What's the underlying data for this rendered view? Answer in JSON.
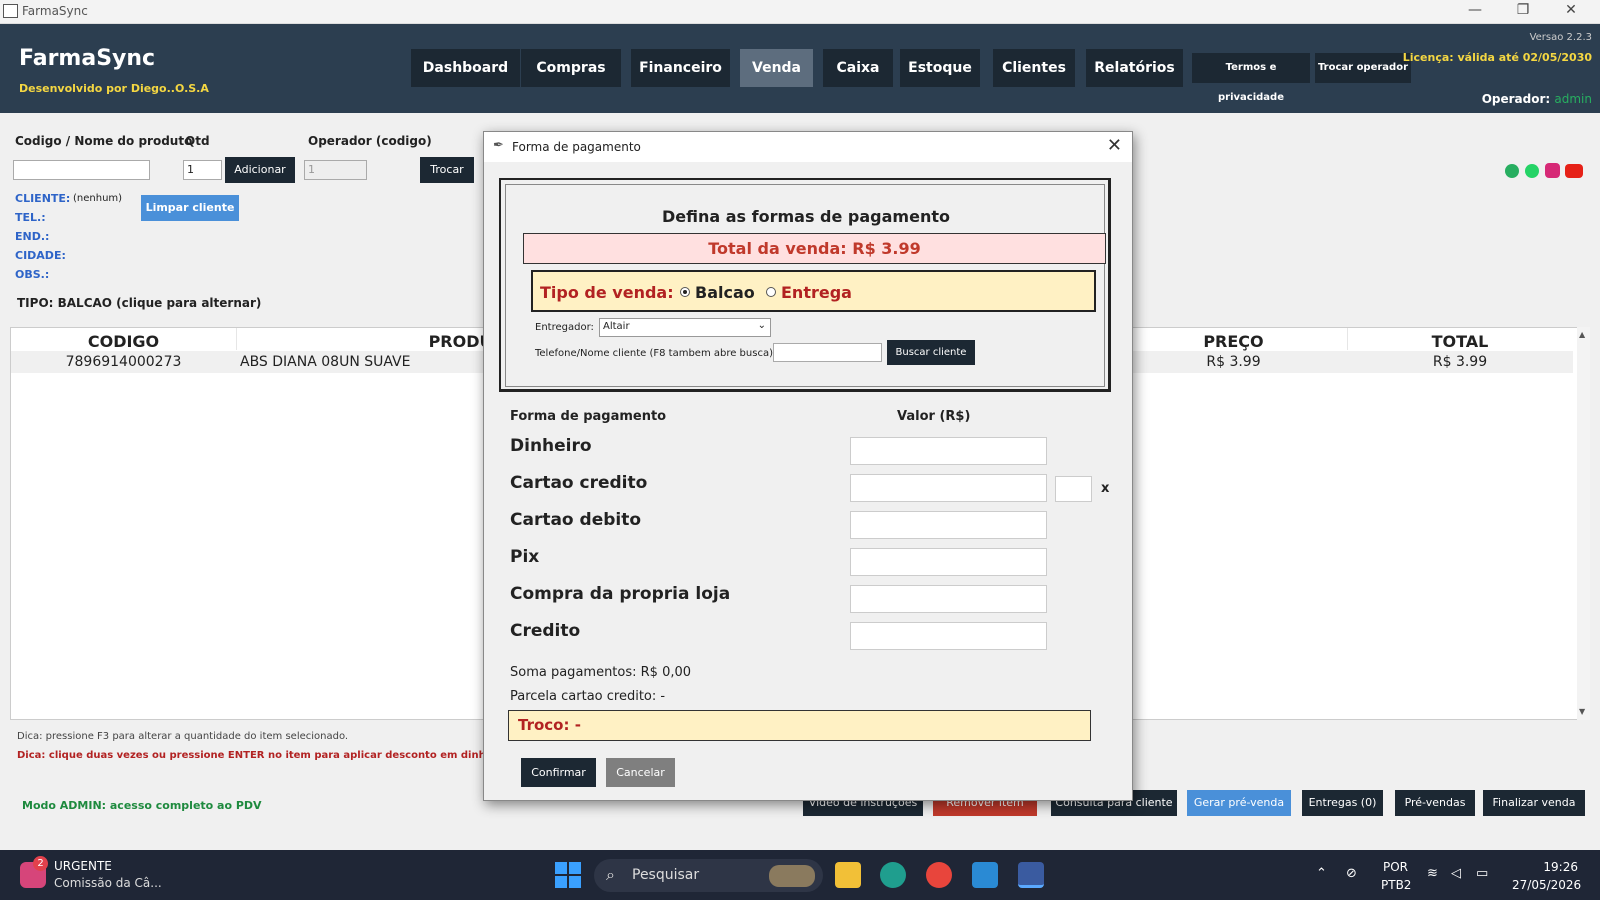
{
  "window": {
    "title": "FarmaSync"
  },
  "header": {
    "brand": "FarmaSync",
    "developer": "Desenvolvido por Diego..O.S.A",
    "nav": [
      "Dashboard",
      "Compras",
      "Financeiro",
      "Venda",
      "Caixa",
      "Estoque",
      "Clientes",
      "Relatórios"
    ],
    "active_nav": "Venda",
    "terms": "Termos e privacidade",
    "switch_operator": "Trocar operador",
    "version": "Versao 2.2.3",
    "license": "Licença: válida até 02/05/2030",
    "operator_label": "Operador:",
    "operator_value": "admin"
  },
  "form": {
    "product_label": "Codigo / Nome do produto",
    "qty_label": "Qtd",
    "qty_value": "1",
    "add_button": "Adicionar",
    "operator_label": "Operador (codigo)",
    "operator_value": "1",
    "switch_button": "Trocar",
    "client_label": "CLIENTE:",
    "client_value": "(nenhum)",
    "clear_client": "Limpar cliente",
    "tel_label": "TEL.:",
    "end_label": "END.:",
    "city_label": "CIDADE:",
    "obs_label": "OBS.:",
    "tipo": "TIPO: BALCAO  (clique para alternar)"
  },
  "table": {
    "headers": [
      "CODIGO",
      "PRODUT",
      "PREÇO",
      "TOTAL"
    ],
    "rows": [
      {
        "codigo": "7896914000273",
        "produto": "ABS DIANA 08UN SUAVE",
        "preco": "R$ 3.99",
        "total": "R$ 3.99"
      }
    ]
  },
  "tips": {
    "tip1": "Dica: pressione F3 para alterar a quantidade do item selecionado.",
    "tip2": "Dica: clique duas vezes ou pressione ENTER no item para aplicar desconto em dinheiro.",
    "mode": "Modo ADMIN: acesso completo ao PDV"
  },
  "bottom_buttons": [
    "Video de instruções",
    "Remover item",
    "Consulta para cliente",
    "Gerar pré-venda",
    "Entregas (0)",
    "Pré-vendas",
    "Finalizar venda"
  ],
  "modal": {
    "title": "Forma de pagamento",
    "heading": "Defina as formas de pagamento",
    "total": "Total da venda: R$ 3.99",
    "tipo_label": "Tipo de venda:",
    "opt_balcao": "Balcao",
    "opt_entrega": "Entrega",
    "selected_tipo": "Balcao",
    "entregador_label": "Entregador:",
    "entregador_value": "Altair",
    "phone_label": "Telefone/Nome cliente (F8 tambem abre busca):",
    "search_button": "Buscar cliente",
    "fp_header": "Forma de pagamento",
    "valor_header": "Valor (R$)",
    "methods": [
      "Dinheiro",
      "Cartao credito",
      "Cartao debito",
      "Pix",
      "Compra da propria loja",
      "Credito"
    ],
    "installments_x": "x",
    "sum": "Soma pagamentos: R$ 0,00",
    "installment": "Parcela cartao credito: -",
    "change": "Troco: -",
    "confirm": "Confirmar",
    "cancel": "Cancelar"
  },
  "taskbar": {
    "notif_count": "2",
    "notif_title": "URGENTE",
    "notif_text": "Comissão da Câ...",
    "search": "Pesquisar",
    "lang1": "POR",
    "lang2": "PTB2",
    "time": "19:26",
    "date": "27/05/2026"
  },
  "colors": {
    "header": "#2c3e50",
    "accent_blue": "#4a90d9",
    "alert_red": "#c0392b",
    "highlight": "#fff1c4"
  }
}
